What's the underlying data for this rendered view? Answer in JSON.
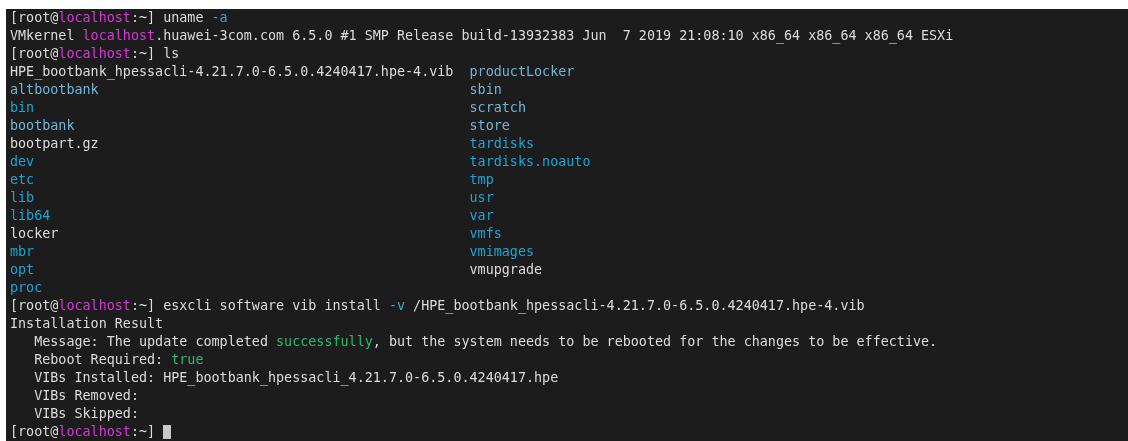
{
  "terminal": {
    "lines": [
      {
        "kind": "line",
        "segments": [
          {
            "text": "[root@",
            "kind": "plain"
          },
          {
            "text": "localhost",
            "kind": "host"
          },
          {
            "text": ":~] uname ",
            "kind": "plain"
          },
          {
            "text": "-a",
            "kind": "flag"
          }
        ]
      },
      {
        "kind": "line",
        "segments": [
          {
            "text": "VMkernel ",
            "kind": "plain"
          },
          {
            "text": "localhost",
            "kind": "host"
          },
          {
            "text": ".huawei-3com.com 6.5.0 #1 SMP Release build-13932383 Jun  7 2019 21:08:10 x86_64 x86_64 x86_64 ESXi",
            "kind": "plain"
          }
        ]
      },
      {
        "kind": "line",
        "segments": [
          {
            "text": "[root@",
            "kind": "plain"
          },
          {
            "text": "localhost",
            "kind": "host"
          },
          {
            "text": ":~] ls",
            "kind": "plain"
          }
        ]
      },
      {
        "kind": "listing",
        "cells": [
          {
            "text": "HPE_bootbank_hpessacli-4.21.7.0-6.5.0.4240417.hpe-4.vib",
            "kind": "plain"
          },
          {
            "text": "productLocker",
            "kind": "link"
          }
        ]
      },
      {
        "kind": "listing",
        "cells": [
          {
            "text": "altbootbank",
            "kind": "link"
          },
          {
            "text": "sbin",
            "kind": "link"
          }
        ]
      },
      {
        "kind": "listing",
        "cells": [
          {
            "text": "bin",
            "kind": "dir"
          },
          {
            "text": "scratch",
            "kind": "link"
          }
        ]
      },
      {
        "kind": "listing",
        "cells": [
          {
            "text": "bootbank",
            "kind": "link"
          },
          {
            "text": "store",
            "kind": "link"
          }
        ]
      },
      {
        "kind": "listing",
        "cells": [
          {
            "text": "bootpart.gz",
            "kind": "plain"
          },
          {
            "text": "tardisks",
            "kind": "dir"
          }
        ]
      },
      {
        "kind": "listing",
        "cells": [
          {
            "text": "dev",
            "kind": "dir"
          },
          {
            "text": "tardisks.noauto",
            "kind": "dir"
          }
        ]
      },
      {
        "kind": "listing",
        "cells": [
          {
            "text": "etc",
            "kind": "dir"
          },
          {
            "text": "tmp",
            "kind": "dir"
          }
        ]
      },
      {
        "kind": "listing",
        "cells": [
          {
            "text": "lib",
            "kind": "dir"
          },
          {
            "text": "usr",
            "kind": "dir"
          }
        ]
      },
      {
        "kind": "listing",
        "cells": [
          {
            "text": "lib64",
            "kind": "dir"
          },
          {
            "text": "var",
            "kind": "dir"
          }
        ]
      },
      {
        "kind": "listing",
        "cells": [
          {
            "text": "locker",
            "kind": "plain"
          },
          {
            "text": "vmfs",
            "kind": "dir"
          }
        ]
      },
      {
        "kind": "listing",
        "cells": [
          {
            "text": "mbr",
            "kind": "dir"
          },
          {
            "text": "vmimages",
            "kind": "dir"
          }
        ]
      },
      {
        "kind": "listing",
        "cells": [
          {
            "text": "opt",
            "kind": "dir"
          },
          {
            "text": "vmupgrade",
            "kind": "plain"
          }
        ]
      },
      {
        "kind": "listing",
        "cells": [
          {
            "text": "proc",
            "kind": "dir"
          }
        ]
      },
      {
        "kind": "line",
        "segments": [
          {
            "text": "[root@",
            "kind": "plain"
          },
          {
            "text": "localhost",
            "kind": "host"
          },
          {
            "text": ":~] esxcli software vib install ",
            "kind": "plain"
          },
          {
            "text": "-v",
            "kind": "flag"
          },
          {
            "text": " /HPE_bootbank_hpessacli-4.21.7.0-6.5.0.4240417.hpe-4.vib",
            "kind": "plain"
          }
        ]
      },
      {
        "kind": "line",
        "segments": [
          {
            "text": "Installation Result",
            "kind": "plain"
          }
        ]
      },
      {
        "kind": "line",
        "segments": [
          {
            "text": "   Message: The update completed ",
            "kind": "plain"
          },
          {
            "text": "successfully",
            "kind": "green"
          },
          {
            "text": ", but the system needs to be rebooted for the changes to be effective.",
            "kind": "plain"
          }
        ]
      },
      {
        "kind": "line",
        "segments": [
          {
            "text": "   Reboot Required: ",
            "kind": "plain"
          },
          {
            "text": "true",
            "kind": "green"
          }
        ]
      },
      {
        "kind": "line",
        "segments": [
          {
            "text": "   VIBs Installed: HPE_bootbank_hpessacli_4.21.7.0-6.5.0.4240417.hpe",
            "kind": "plain"
          }
        ]
      },
      {
        "kind": "line",
        "segments": [
          {
            "text": "   VIBs Removed:",
            "kind": "plain"
          }
        ]
      },
      {
        "kind": "line",
        "segments": [
          {
            "text": "   VIBs Skipped:",
            "kind": "plain"
          }
        ]
      },
      {
        "kind": "line",
        "cursor": true,
        "segments": [
          {
            "text": "[root@",
            "kind": "plain"
          },
          {
            "text": "localhost",
            "kind": "host"
          },
          {
            "text": ":~] ",
            "kind": "plain"
          }
        ]
      }
    ]
  }
}
